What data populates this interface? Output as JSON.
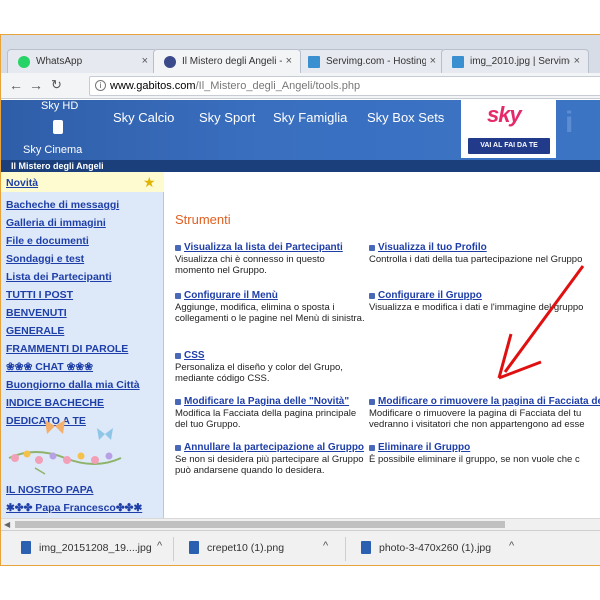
{
  "tabs": [
    {
      "label": "WhatsApp",
      "icon": "whatsapp-icon",
      "icon_color": "#25d366"
    },
    {
      "label": "Il Mistero degli Angeli - (",
      "icon": "forum-icon",
      "icon_color": "#3b4a8a"
    },
    {
      "label": "Servimg.com - Hosting g",
      "icon": "servimg-icon",
      "icon_color": "#3a8fd0"
    },
    {
      "label": "img_2010.jpg | Servimg.c",
      "icon": "servimg-icon",
      "icon_color": "#3a8fd0"
    }
  ],
  "tab_close": "×",
  "address": {
    "domain": "www.gabitos.com",
    "path": "/Il_Mistero_degli_Angeli/tools.php"
  },
  "banner": {
    "sky_hd": "Sky HD",
    "sky_cinema": "Sky Cinema",
    "channels": [
      "Sky Calcio",
      "Sky Sport",
      "Sky Famiglia",
      "Sky Box Sets"
    ],
    "sky_logo": "sky",
    "cta": "VAI AL FAI DA TE"
  },
  "forum_name": "Il Mistero degli Angeli",
  "sidebar": {
    "items": [
      "Novità",
      "Bacheche di messaggi",
      "Galleria di immagini",
      "File e documenti",
      "Sondaggi e test",
      "Lista dei Partecipanti",
      "TUTTI I POST",
      "BENVENUTI",
      "GENERALE",
      "FRAMMENTI DI PAROLE",
      "❀❀❀ CHAT ❀❀❀",
      "Buongiorno dalla mia Città",
      "INDICE BACHECHE",
      "DEDICATO A TE",
      "IL NOSTRO PAPA",
      "✱✤✤ Papa Francesco✤✤✱"
    ]
  },
  "main": {
    "section_title": "Strumenti",
    "tools": [
      {
        "title": "Visualizza la lista dei Partecipanti",
        "desc": "Visualizza chi è connesso in questo momento nel Gruppo."
      },
      {
        "title": "Visualizza il tuo Profilo",
        "desc": "Controlla i dati della tua partecipazione nel Gruppo"
      },
      {
        "title": "Configurare il Menù",
        "desc": "Aggiunge, modifica, elimina o sposta i collegamenti o le pagine nel Menù di sinistra."
      },
      {
        "title": "Configurare il Gruppo",
        "desc": "Visualizza e modifica i dati e l'immagine del gruppo"
      },
      {
        "title": "CSS",
        "desc": "Personaliza el diseño y color del Grupo, mediante código CSS."
      },
      {
        "title": "Modificare la Pagina delle \"Novità\"",
        "desc": "Modifica la Facciata della pagina principale del tuo Gruppo."
      },
      {
        "title": "Modificare o rimuovere la pagina di Facciata de",
        "desc": "Modificare o rimuovere la pagina di Facciata del tu",
        "desc2": "vedranno i visitatori che non appartengono ad esse"
      },
      {
        "title": "Annullare la partecipazione al Gruppo",
        "desc": "Se non si desidera più partecipare al Gruppo può andarsene quando lo desidera."
      },
      {
        "title": "Eliminare il Gruppo",
        "desc": "È possibile eliminare il gruppo, se non vuole che c"
      }
    ]
  },
  "downloads": [
    {
      "name": "img_20151208_19....jpg"
    },
    {
      "name": "crepet10 (1).png"
    },
    {
      "name": "photo-3-470x260 (1).jpg"
    }
  ],
  "download_chevron": "^",
  "colors": {
    "link": "#1f3fa8",
    "section_title": "#e06020",
    "annotation_arrow": "#e01010",
    "banner_blue": "#3a6fc0"
  }
}
